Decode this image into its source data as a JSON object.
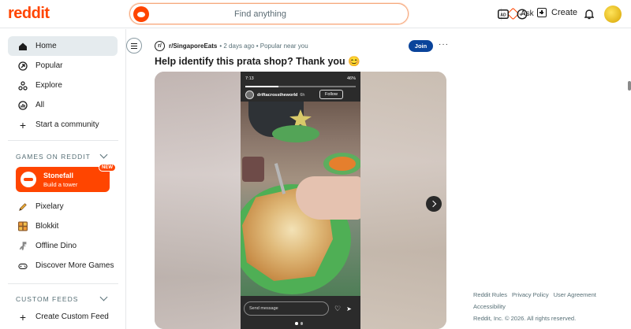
{
  "header": {
    "logo": "reddit",
    "search_placeholder": "Find anything",
    "ask_label": "Ask",
    "create_label": "Create"
  },
  "sidebar": {
    "nav": [
      {
        "label": "Home",
        "icon": "home-icon",
        "active": true
      },
      {
        "label": "Popular",
        "icon": "popular-icon"
      },
      {
        "label": "Explore",
        "icon": "explore-icon"
      },
      {
        "label": "All",
        "icon": "all-icon"
      },
      {
        "label": "Start a community",
        "icon": "plus-icon"
      }
    ],
    "games_title": "GAMES ON REDDIT",
    "featured_game": {
      "name": "Stonefall",
      "subtitle": "Build a tower",
      "badge": "NEW"
    },
    "games": [
      {
        "label": "Pixelary",
        "icon": "pencil-icon"
      },
      {
        "label": "Blokkit",
        "icon": "blocks-icon"
      },
      {
        "label": "Offline Dino",
        "icon": "dino-icon"
      },
      {
        "label": "Discover More Games",
        "icon": "gamepad-icon"
      }
    ],
    "custom_feeds_title": "CUSTOM FEEDS",
    "create_feed_label": "Create Custom Feed"
  },
  "post": {
    "subreddit": "r/SingaporeEats",
    "meta": "• 2 days ago • Popular near you",
    "join_label": "Join",
    "title": "Help identify this prata shop? Thank you 😊",
    "story": {
      "time": "7:13",
      "battery": "46%",
      "username": "driftacrosstheworld",
      "ago": "6h",
      "follow_label": "Follow",
      "message_placeholder": "Send message"
    }
  },
  "footer": {
    "links": [
      "Reddit Rules",
      "Privacy Policy",
      "User Agreement",
      "Accessibility"
    ],
    "copyright": "Reddit, Inc. © 2026. All rights reserved."
  },
  "colors": {
    "brand": "#ff4500",
    "join": "#0a449b"
  }
}
